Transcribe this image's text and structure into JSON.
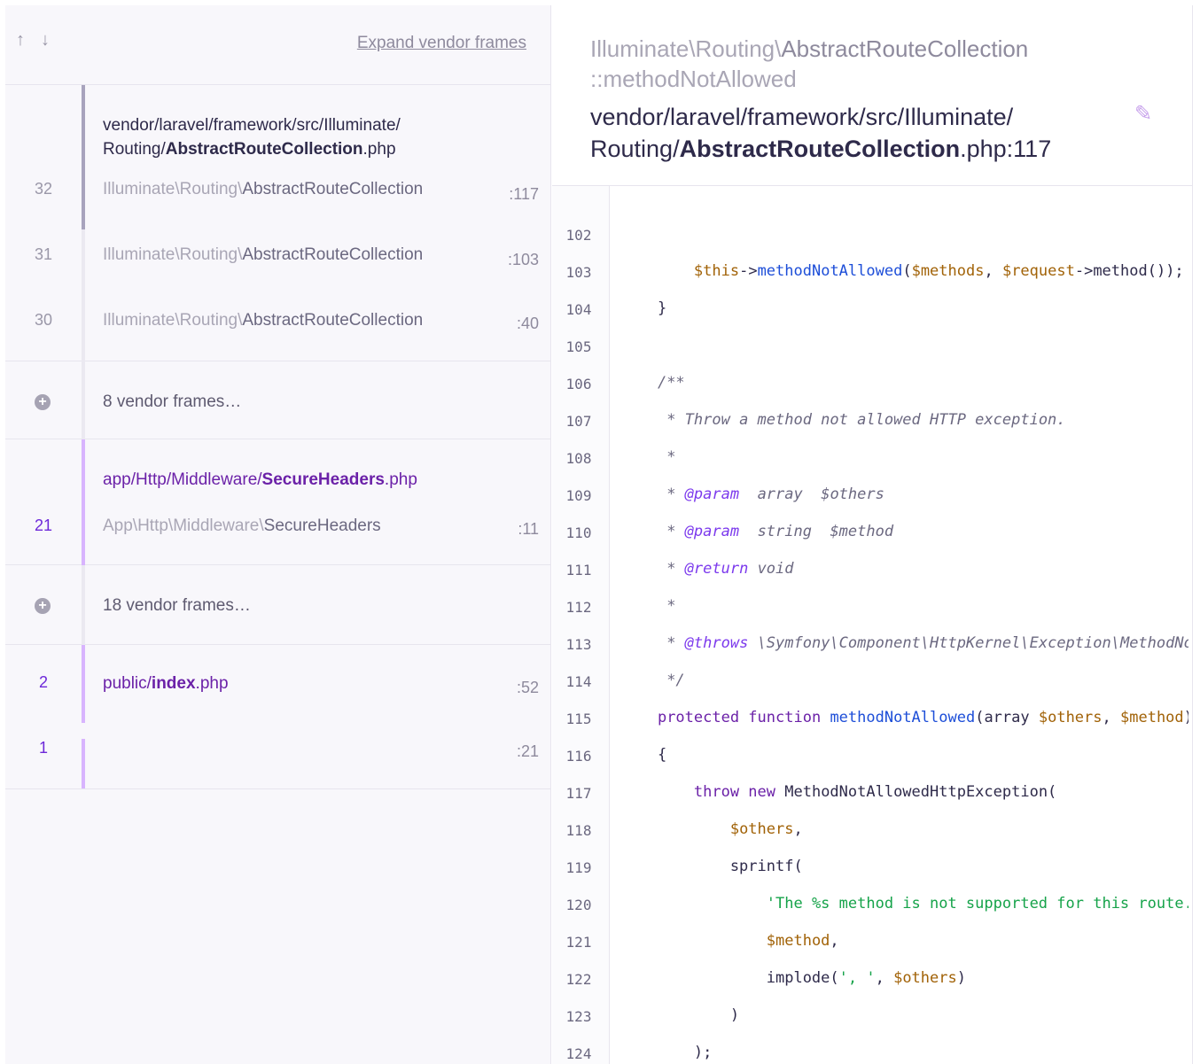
{
  "left": {
    "arrows": {
      "up": "↑",
      "down": "↓"
    },
    "expand_label": "Expand vendor frames",
    "group1": {
      "path_prefix": "vendor/laravel/framework/src/Illuminate/",
      "path_dir": "Routing/",
      "path_file": "AbstractRouteCollection",
      "path_ext": ".php",
      "rows": [
        {
          "num": "32",
          "ns": "Illuminate\\Routing\\",
          "cls": "AbstractRouteCollection",
          "line": ":117"
        },
        {
          "num": "31",
          "ns": "Illuminate\\Routing\\",
          "cls": "AbstractRouteCollection",
          "line": ":103"
        },
        {
          "num": "30",
          "ns": "Illuminate\\Routing\\",
          "cls": "AbstractRouteCollection",
          "line": ":40"
        }
      ]
    },
    "vendor1": {
      "icon": "+",
      "label": "8 vendor frames…"
    },
    "group2": {
      "path_dir": "app/Http/Middleware/",
      "path_file": "SecureHeaders",
      "path_ext": ".php",
      "row": {
        "num": "21",
        "ns": "App\\Http\\Middleware\\",
        "cls": "SecureHeaders",
        "line": ":11"
      }
    },
    "vendor2": {
      "icon": "+",
      "label": "18 vendor frames…"
    },
    "group3": {
      "path_dir": "public/",
      "path_file": "index",
      "path_ext": ".php",
      "rows": [
        {
          "num": "2",
          "line": ":52"
        },
        {
          "num": "1",
          "line": ":21"
        }
      ]
    }
  },
  "right": {
    "class_ns": "Illuminate\\Routing\\",
    "class_name": "AbstractRouteCollection",
    "method": "::methodNotAllowed",
    "file_prefix": "vendor/laravel/framework/src/Illuminate/",
    "file_dir": "Routing/",
    "file_name": "AbstractRouteCollection",
    "file_ext": ".php:117",
    "edit_icon": "✎",
    "line_numbers": [
      "102",
      "103",
      "104",
      "105",
      "106",
      "107",
      "108",
      "109",
      "110",
      "111",
      "112",
      "113",
      "114",
      "115",
      "116",
      "117",
      "118",
      "119",
      "120",
      "121",
      "122",
      "123",
      "124"
    ]
  },
  "colors": {
    "accent": "#7c3aed",
    "active_bar": "#a8a3bd",
    "app_bar": "#d8b4fe"
  }
}
